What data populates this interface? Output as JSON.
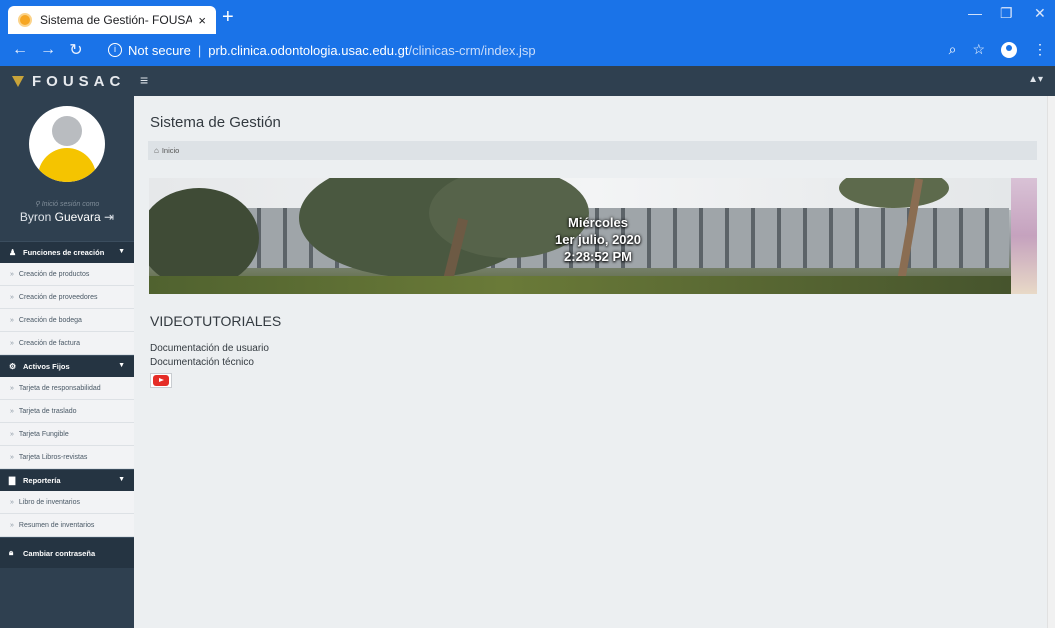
{
  "browser": {
    "tab_title": "Sistema de Gestión- FOUSAC",
    "tab_close": "×",
    "new_tab": "+",
    "security": "Not secure",
    "url_host": "prb.clinica.odontologia.usac.edu.gt",
    "url_path": "/clinicas-crm/index.jsp"
  },
  "app": {
    "logo_text": "FOUSAC",
    "menu_icon": "hamburger-icon",
    "user_menu_icon": "user-icon"
  },
  "sidebar": {
    "login_as": "Inició sesión como",
    "user_first": "Byron",
    "user_last": "Guevara",
    "sections": [
      {
        "label": "Funciones de creación",
        "icon": "user-icon",
        "items": [
          "Creación de productos",
          "Creación de proveedores",
          "Creación de bodega",
          "Creación de factura"
        ]
      },
      {
        "label": "Activos Fijos",
        "icon": "assets-icon",
        "items": [
          "Tarjeta de responsabilidad",
          "Tarjeta de traslado",
          "Tarjeta Fungible",
          "Tarjeta Libros-revistas"
        ]
      },
      {
        "label": "Reportería",
        "icon": "document-icon",
        "items": [
          "Libro de inventarios",
          "Resumen de inventarios"
        ]
      },
      {
        "label": "Cambiar contraseña",
        "icon": "lock-icon",
        "items": []
      }
    ]
  },
  "main": {
    "page_title": "Sistema de Gestión",
    "breadcrumb": "Inicio",
    "banner": {
      "day": "Miércoles",
      "date": "1er julio, 2020",
      "time": "2:28:52 PM"
    },
    "videos_title": "VIDEOTUTORIALES",
    "links": [
      "Documentación de usuario",
      "Documentación técnico"
    ],
    "video_icon": "youtube-icon"
  },
  "colors": {
    "chrome_blue": "#1a73e8",
    "navbar": "#2f4050",
    "sidebar_section": "#253442",
    "content_bg": "#eceff1",
    "avatar_yellow": "#f5c400"
  }
}
